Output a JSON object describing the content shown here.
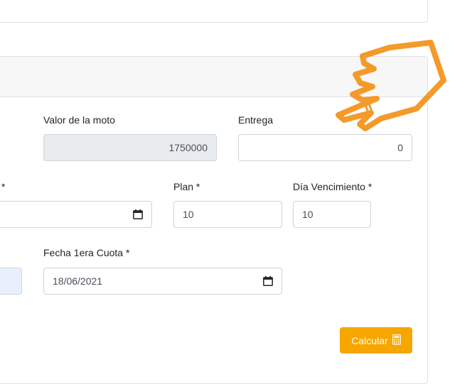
{
  "form": {
    "valor_moto": {
      "label": "Valor de la moto",
      "value": "1750000"
    },
    "entrega": {
      "label": "Entrega",
      "value": "0"
    },
    "cut_label": "*",
    "plan": {
      "label": "Plan *",
      "value": "10"
    },
    "dia_vencimiento": {
      "label": "Día Vencimiento *",
      "value": "10"
    },
    "fecha_cuota": {
      "label": "Fecha 1era Cuota *",
      "value": "18/06/2021"
    }
  },
  "actions": {
    "calcular_label": "Calcular"
  },
  "colors": {
    "accent": "#f7a600",
    "pointer": "#f49a2a",
    "readonly_bg": "#e9ecef"
  }
}
